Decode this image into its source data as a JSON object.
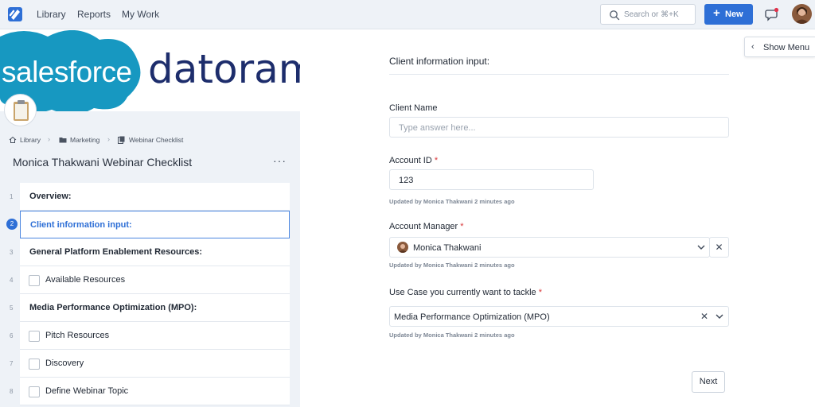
{
  "topbar": {
    "nav": [
      "Library",
      "Reports",
      "My Work"
    ],
    "search_placeholder": "Search or ⌘+K",
    "new_label": "New"
  },
  "banner": {
    "brand_left": "salesforce",
    "brand_right": "datorama",
    "brand_left_color": "#1798c1",
    "brand_right_color": "#1d2d6c"
  },
  "breadcrumb": [
    "Library",
    "Marketing",
    "Webinar Checklist"
  ],
  "checklist": {
    "title": "Monica Thakwani Webinar Checklist",
    "active_step": 2,
    "steps": [
      {
        "num": "1",
        "label": "Overview:",
        "type": "header"
      },
      {
        "num": "2",
        "label": "Client information input:",
        "type": "form"
      },
      {
        "num": "3",
        "label": "General Platform Enablement Resources:",
        "type": "header"
      },
      {
        "num": "4",
        "label": "Available Resources",
        "type": "task"
      },
      {
        "num": "5",
        "label": "Media Performance Optimization (MPO):",
        "type": "header"
      },
      {
        "num": "6",
        "label": "Pitch Resources",
        "type": "task"
      },
      {
        "num": "7",
        "label": "Discovery",
        "type": "task"
      },
      {
        "num": "8",
        "label": "Define Webinar Topic",
        "type": "task"
      }
    ]
  },
  "show_menu_label": "Show Menu",
  "form": {
    "section_title": "Client information input:",
    "client_name": {
      "label": "Client Name",
      "placeholder": "Type answer here..."
    },
    "account_id": {
      "label": "Account ID",
      "required": "*",
      "value": "123",
      "updated": "Updated by Monica Thakwani 2 minutes ago"
    },
    "account_manager": {
      "label": "Account Manager",
      "required": "*",
      "value": "Monica Thakwani",
      "updated": "Updated by Monica Thakwani 2 minutes ago"
    },
    "use_case": {
      "label": "Use Case you currently want to tackle",
      "required": "*",
      "value": "Media Performance Optimization (MPO)",
      "updated": "Updated by Monica Thakwani 2 minutes ago"
    },
    "next_label": "Next"
  },
  "colors": {
    "accent": "#2e6fd6",
    "required": "#d9383a",
    "sidebar_bg": "#eef2f7",
    "notification_dot": "#e0334c"
  },
  "icons": [
    "app-logo-icon",
    "search-icon",
    "plus-icon",
    "chat-icon",
    "home-icon",
    "folder-icon",
    "checklist-icon",
    "more-icon",
    "chevron-left-icon",
    "chevron-down-icon",
    "close-icon",
    "clipboard-icon"
  ]
}
